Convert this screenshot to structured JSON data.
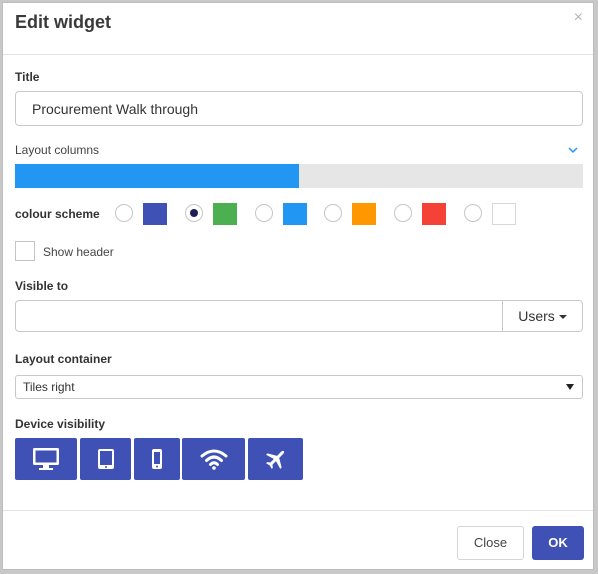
{
  "dialog": {
    "title": "Edit widget",
    "close_glyph": "×"
  },
  "title_field": {
    "label": "Title",
    "value": "Procurement Walk through"
  },
  "layout_columns": {
    "label": "Layout columns",
    "fill_fraction": 0.5,
    "fill_color": "#2196f3",
    "track_color": "#e6e6e6",
    "icon": "chevron-down-icon"
  },
  "colour_scheme": {
    "label": "colour scheme",
    "options": [
      {
        "name": "indigo",
        "color": "#3f51b5",
        "selected": false
      },
      {
        "name": "green",
        "color": "#4caf50",
        "selected": true
      },
      {
        "name": "blue",
        "color": "#2196f3",
        "selected": false
      },
      {
        "name": "orange",
        "color": "#ff9800",
        "selected": false
      },
      {
        "name": "red",
        "color": "#f44336",
        "selected": false
      },
      {
        "name": "white",
        "color": "#ffffff",
        "selected": false
      }
    ]
  },
  "show_header": {
    "label": "Show header",
    "checked": false
  },
  "visible_to": {
    "label": "Visible to",
    "value": "",
    "dropdown_label": "Users"
  },
  "layout_container": {
    "label": "Layout container",
    "selected": "Tiles right"
  },
  "device_visibility": {
    "label": "Device visibility",
    "devices": [
      "desktop-icon",
      "tablet-icon",
      "mobile-icon",
      "wifi-icon",
      "airplane-icon"
    ],
    "button_color": "#3f51b5"
  },
  "footer": {
    "close_label": "Close",
    "ok_label": "OK"
  },
  "colors": {
    "primary": "#3f51b5",
    "accent": "#2196f3"
  }
}
